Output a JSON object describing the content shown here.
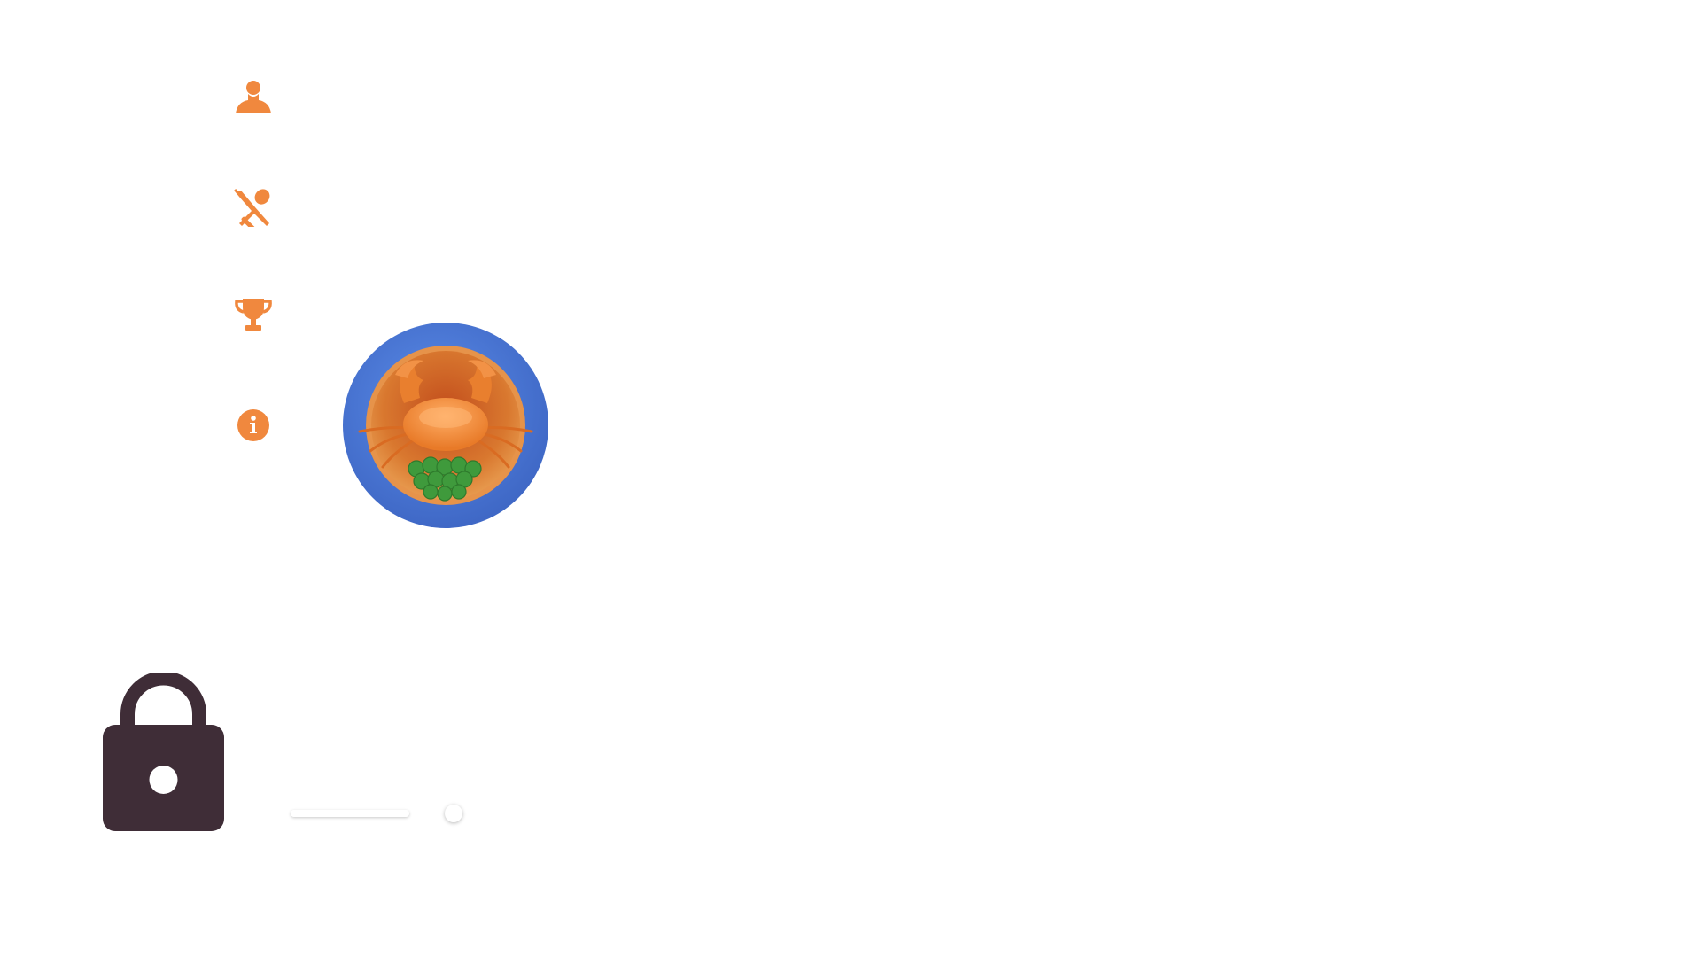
{
  "colors": {
    "accent": "#f0883e",
    "lock": "#3f2d37",
    "badge_ring": "#4a78d6",
    "badge_plate": "#d9782f",
    "crab": "#f08a38",
    "greens": "#3f9a3c"
  },
  "nav": {
    "items": [
      {
        "id": "profile",
        "icon": "person-icon"
      },
      {
        "id": "dishes",
        "icon": "fork-spoon-icon"
      },
      {
        "id": "trophy",
        "icon": "trophy-icon"
      },
      {
        "id": "info",
        "icon": "info-icon"
      }
    ]
  },
  "level": {
    "dish_icon": "crab-dish-icon",
    "locked": true,
    "lock_icon": "lock-icon",
    "progress_fraction": 1.0
  }
}
